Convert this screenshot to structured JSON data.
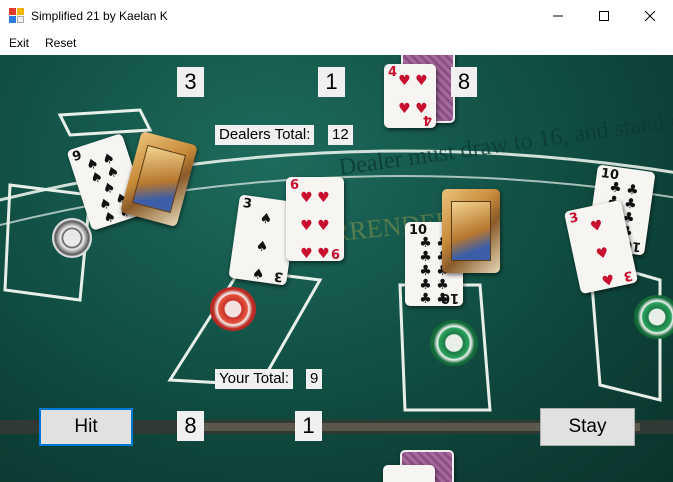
{
  "window": {
    "title": "Simplified 21 by Kaelan K",
    "minimize_glyph": "—",
    "maximize_glyph": "☐",
    "close_glyph": "✕"
  },
  "menu": {
    "items": [
      "Exit",
      "Reset"
    ]
  },
  "dealer": {
    "card_value_left": "3",
    "card_value_right": "1",
    "card_value_extra": "8",
    "total_label": "Dealers Total:",
    "total_value": "12"
  },
  "player": {
    "total_label": "Your Total:",
    "total_value": "9",
    "card_value_left": "8",
    "card_value_right": "1"
  },
  "buttons": {
    "hit": "Hit",
    "stay": "Stay"
  },
  "colors": {
    "felt": "#14574a",
    "button_focus": "#0078d7"
  }
}
